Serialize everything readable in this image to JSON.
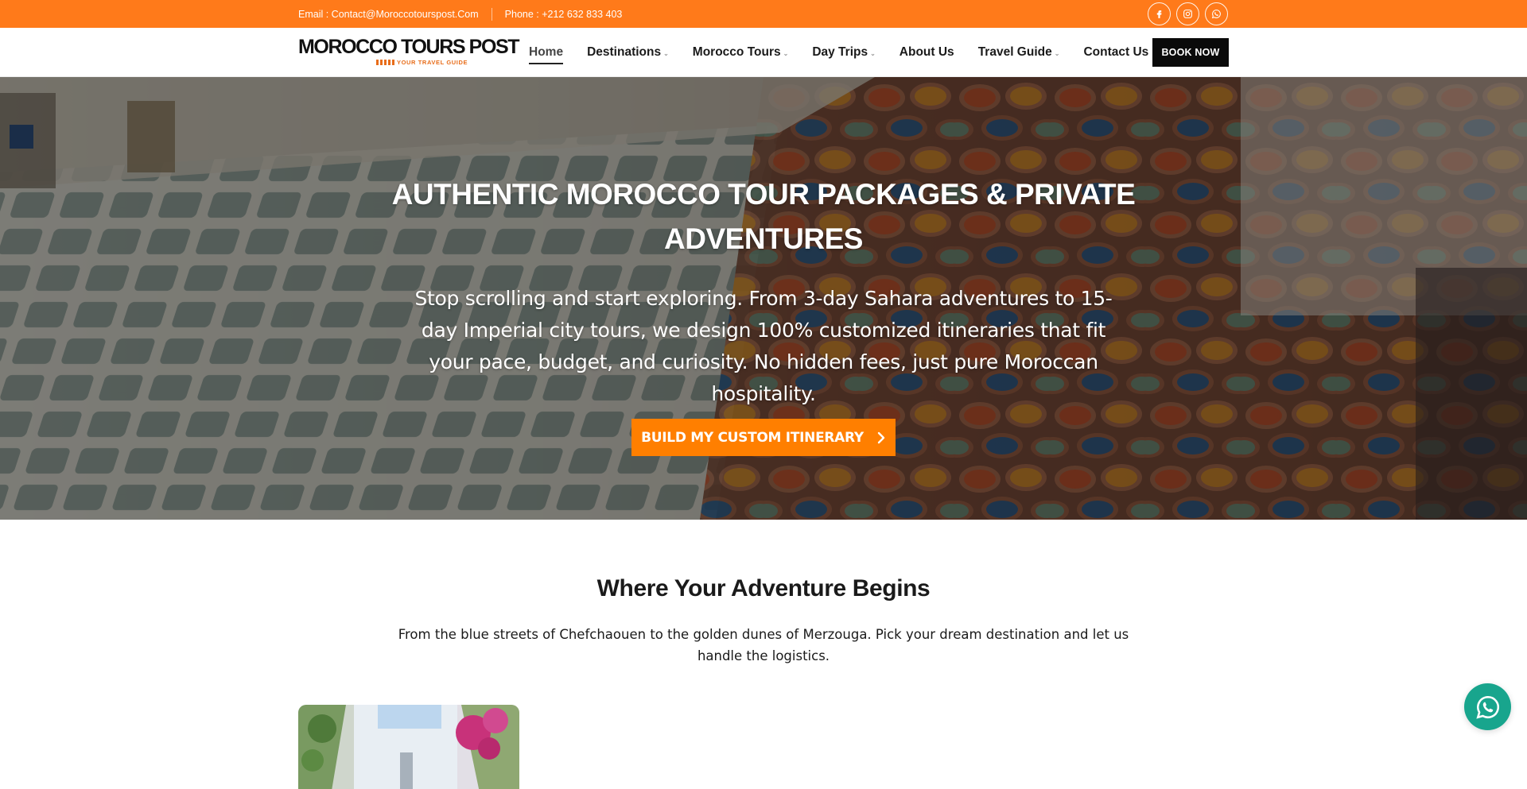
{
  "topbar": {
    "email": "Email : Contact@Moroccotourspost.Com",
    "phone": "Phone : +212 632 833 403",
    "social": [
      "facebook-icon",
      "instagram-icon",
      "whatsapp-icon"
    ]
  },
  "header": {
    "logo_text": "MOROCCO TOURS POST",
    "logo_tagline": "YOUR TRAVEL GUIDE",
    "nav": [
      {
        "label": "Home",
        "active": true,
        "dropdown": false
      },
      {
        "label": "Destinations",
        "active": false,
        "dropdown": true
      },
      {
        "label": "Morocco Tours",
        "active": false,
        "dropdown": true
      },
      {
        "label": "Day Trips",
        "active": false,
        "dropdown": true
      },
      {
        "label": "About Us",
        "active": false,
        "dropdown": false
      },
      {
        "label": "Travel Guide",
        "active": false,
        "dropdown": true
      },
      {
        "label": "Contact Us",
        "active": false,
        "dropdown": false
      }
    ],
    "book_label": "BOOK NOW"
  },
  "hero": {
    "title": "AUTHENTIC MOROCCO TOUR PACKAGES & PRIVATE ADVENTURES",
    "subtitle": "Stop scrolling and start exploring. From 3-day Sahara adventures to 15-day Imperial city tours, we design 100% customized itineraries that fit your pace, budget, and curiosity. No hidden fees, just pure Moroccan hospitality.",
    "cta_label": "BUILD MY CUSTOM ITINERARY"
  },
  "destinations": {
    "title": "Where Your Adventure Begins",
    "text": "From the blue streets of Chefchaouen to the golden dunes of Merzouga. Pick your dream destination and let us handle the logistics."
  },
  "colors": {
    "accent": "#ff7a1a",
    "cta": "#ff7f00",
    "dark": "#0a0a0a",
    "whatsapp": "#18a58d"
  }
}
